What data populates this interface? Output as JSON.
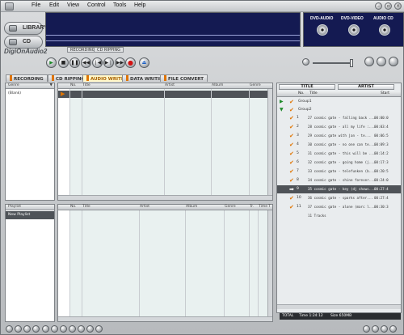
{
  "menu": [
    "File",
    "Edit",
    "View",
    "Control",
    "Tools",
    "Help"
  ],
  "nav": {
    "library": "LIBRARY",
    "cd": "CD"
  },
  "logo": "DigiOnAudio2",
  "display_tabs": [
    "RECORDING",
    "CD RIPPING"
  ],
  "devices": [
    "DVD-AUDIO",
    "DVD-VIDEO",
    "AUDIO CD"
  ],
  "tabs": [
    "RECORDING",
    "CD RIPPING",
    "AUDIO WRITING",
    "DATA WRITING",
    "FILE CONVERT"
  ],
  "colors": {
    "accent": "#e07400",
    "display_bg": "#141a52",
    "selection": "#4f5358"
  },
  "genre_panel": {
    "header": "Genre",
    "items": [
      "(Blank)"
    ]
  },
  "playlist_panel": {
    "header": "Playlist",
    "items": [
      "New Playlist"
    ]
  },
  "main_table": {
    "columns": [
      "No.",
      "Title",
      "Artist",
      "Album",
      "Genre"
    ]
  },
  "lower_table": {
    "columns": [
      "No.",
      "Title",
      "Artist",
      "Album",
      "Genre",
      "Tr.",
      "Time",
      "T"
    ]
  },
  "right_panel": {
    "tabs": [
      "TITLE",
      "ARTIST"
    ],
    "columns": [
      "No.",
      "Title",
      "Start"
    ],
    "groups": [
      "Group1",
      "Group2"
    ],
    "tracks": [
      {
        "num": "1",
        "title": "27 cosmic gate - falling back ...",
        "start": "00:00:0"
      },
      {
        "num": "2",
        "title": "28 cosmic gate - all my life :...",
        "start": "00:03:4"
      },
      {
        "num": "3",
        "title": "29 cosmic gate with jan - te...",
        "start": "00:06:5"
      },
      {
        "num": "4",
        "title": "30 cosmic gate - no one can te...",
        "start": "00:09:3"
      },
      {
        "num": "5",
        "title": "31 cosmic gate - this will be ...",
        "start": "00:14:2"
      },
      {
        "num": "6",
        "title": "32 cosmic gate - going home (j...",
        "start": "00:17:3"
      },
      {
        "num": "7",
        "title": "33 cosmic gate - telefunken (b...",
        "start": "00:20:5"
      },
      {
        "num": "8",
        "title": "34 cosmic gate - shine forever...",
        "start": "00:24:0"
      },
      {
        "num": "9",
        "title": "35 cosmic gate - key (dj shows...",
        "start": "00:27:4"
      },
      {
        "num": "10",
        "title": "36 cosmic gate - sparks after...",
        "start": "00:27:4"
      },
      {
        "num": "11",
        "title": "37 cosmic gate - alone (marc l...",
        "start": "00:30:3"
      }
    ],
    "summary": "11 Tracks",
    "footer": {
      "total": "TOTAL",
      "time": "Time 1:24:12",
      "size": "Size 650MB"
    }
  }
}
